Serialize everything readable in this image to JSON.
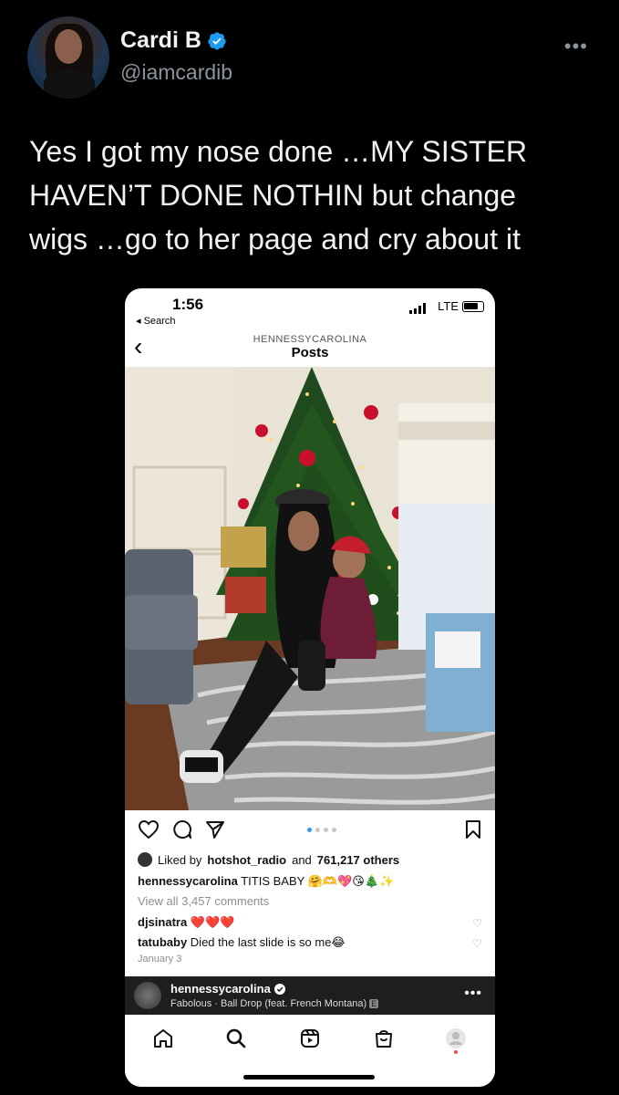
{
  "tweet": {
    "display_name": "Cardi B",
    "handle": "@iamcardib",
    "text_line1": "Yes I got my nose done …MY SISTER",
    "text_line2": "HAVEN’T DONE NOTHIN but change",
    "text_line3": "wigs …go to her page and cry about it",
    "verified_color": "#1d9bf0"
  },
  "phone": {
    "time": "1:56",
    "back_label": "◂ Search",
    "network": "LTE",
    "nav_username": "HENNESSYCAROLINA",
    "nav_title": "Posts",
    "likes_prefix": "Liked by",
    "likes_user": "hotshot_radio",
    "likes_middle": "and",
    "likes_count": "761,217 others",
    "caption_user": "hennessycarolina",
    "caption_text": "TITIS BABY 🤗🫶💖😘🎄✨",
    "view_all": "View all 3,457 comments",
    "comments": [
      {
        "user": "djsinatra",
        "text": "❤️❤️❤️"
      },
      {
        "user": "tatubaby",
        "text": "Died the last slide is so me😂"
      }
    ],
    "date": "January 3",
    "music": {
      "user": "hennessycarolina",
      "track": "Fabolous · Ball Drop (feat. French Montana)",
      "explicit": "E"
    },
    "carousel": {
      "count": 4,
      "active_index": 0
    }
  },
  "icons": {
    "verified": "verified-badge-icon",
    "more": "more-horizontal-icon",
    "like": "heart-icon",
    "comment": "comment-icon",
    "share": "send-icon",
    "save": "bookmark-icon",
    "home": "home-icon",
    "search": "search-icon",
    "reels": "reels-icon",
    "shop": "shop-bag-icon",
    "profile": "profile-icon"
  }
}
